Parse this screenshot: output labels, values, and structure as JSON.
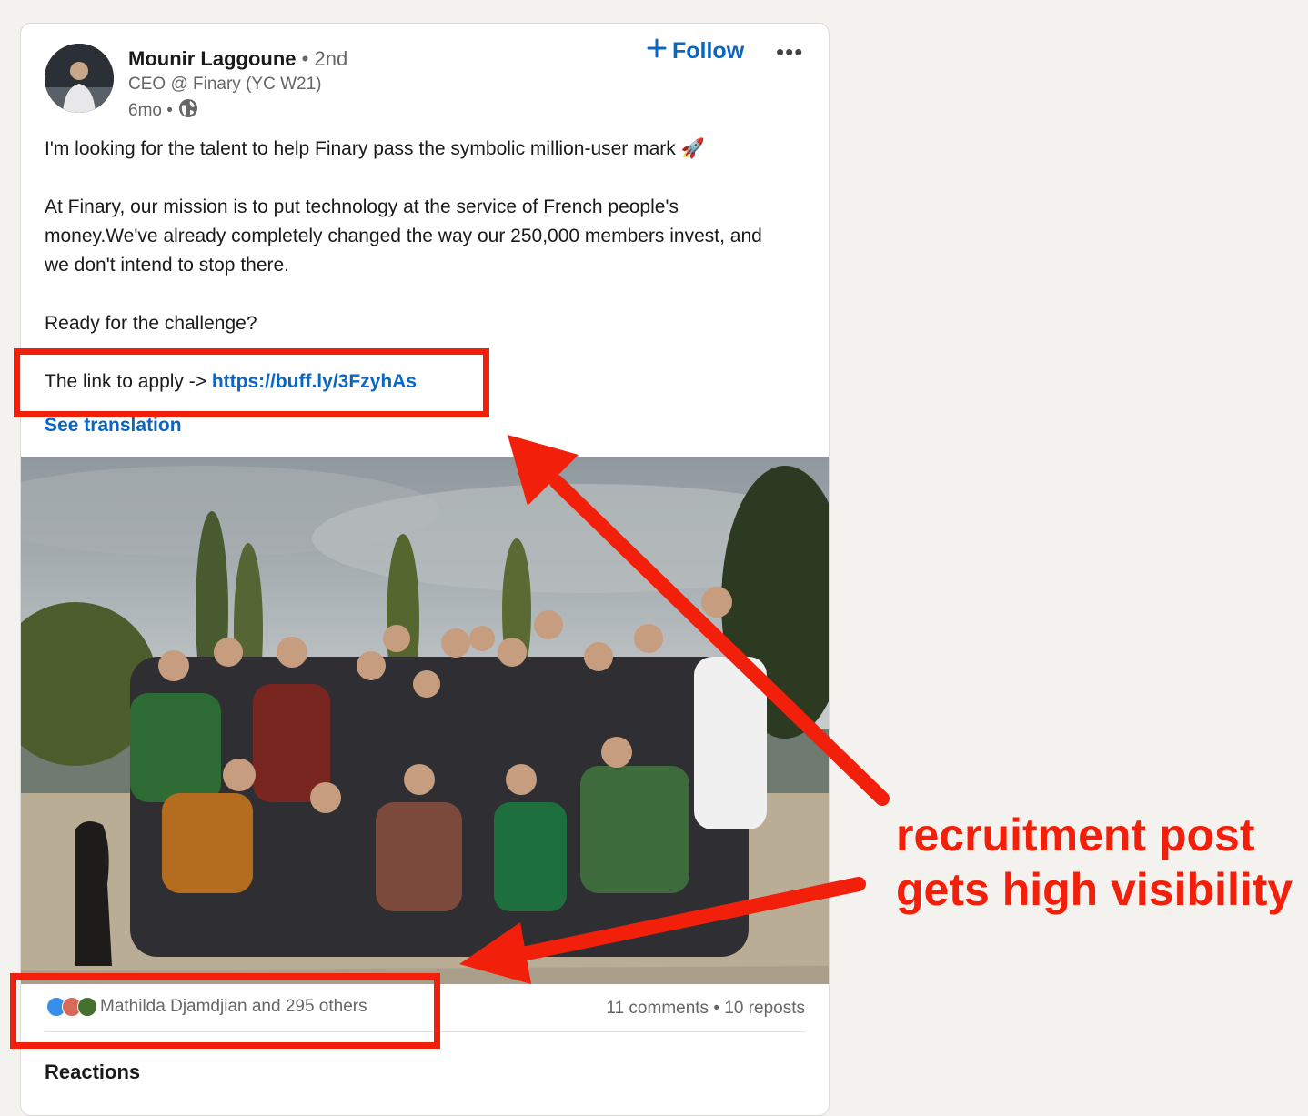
{
  "post": {
    "author": {
      "name": "Mounir Laggoune",
      "degree": "• 2nd",
      "headline": "CEO @ Finary (YC W21)",
      "time": "6mo •",
      "visibility_icon": "globe-icon"
    },
    "follow_label": "Follow",
    "more_label": "•••",
    "body": {
      "p1": "I'm looking for the talent to help Finary pass the symbolic million-user mark 🚀",
      "p2": "At Finary, our mission is to put technology at the service of French people's money.We've already completely changed the way our 250,000 members invest, and we don't intend to stop there.",
      "p3": "Ready for the challenge?",
      "p4_prefix": "The link to apply -> ",
      "p4_link": "https://buff.ly/3FzyhAs"
    },
    "see_translation": "See translation",
    "reactions_text": "Mathilda Djamdjian and 295 others",
    "stats_text": "11 comments • 10 reposts",
    "reactions_heading": "Reactions"
  },
  "annotation": {
    "caption_line1": "recruitment post",
    "caption_line2": "gets high visibility"
  },
  "colors": {
    "linkedin_blue": "#0a66c2",
    "annotation_red": "#f2200a"
  }
}
